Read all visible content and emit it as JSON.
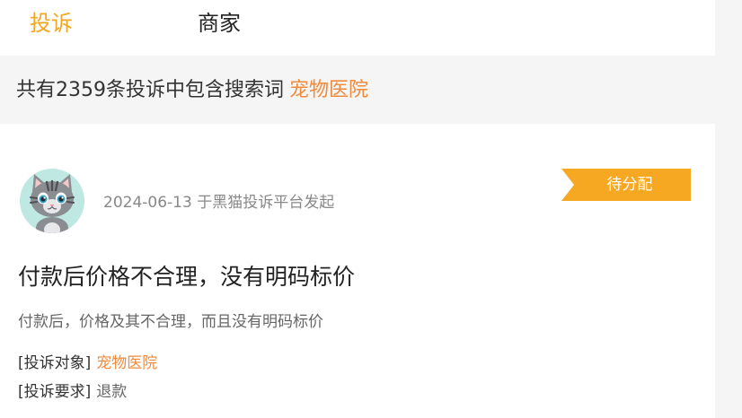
{
  "tabs": {
    "complaints_label": "投诉",
    "merchants_label": "商家"
  },
  "search": {
    "summary_text": "共有2359条投诉中包含搜索词",
    "keyword": "宠物医院"
  },
  "complaint": {
    "meta_text": "2024-06-13 于黑猫投诉平台发起",
    "status_badge": "待分配",
    "title": "付款后价格不合理，没有明码标价",
    "description": "付款后，价格及其不合理，而且没有明码标价",
    "target_label": "[投诉对象]",
    "target_value": "宠物医院",
    "request_label": "[投诉要求]",
    "request_value": "退款"
  },
  "colors": {
    "accent": "#f5a623",
    "keyword": "#f08a3c",
    "badge": "#f7a823",
    "avatar_bg": "#bfe8e2"
  }
}
